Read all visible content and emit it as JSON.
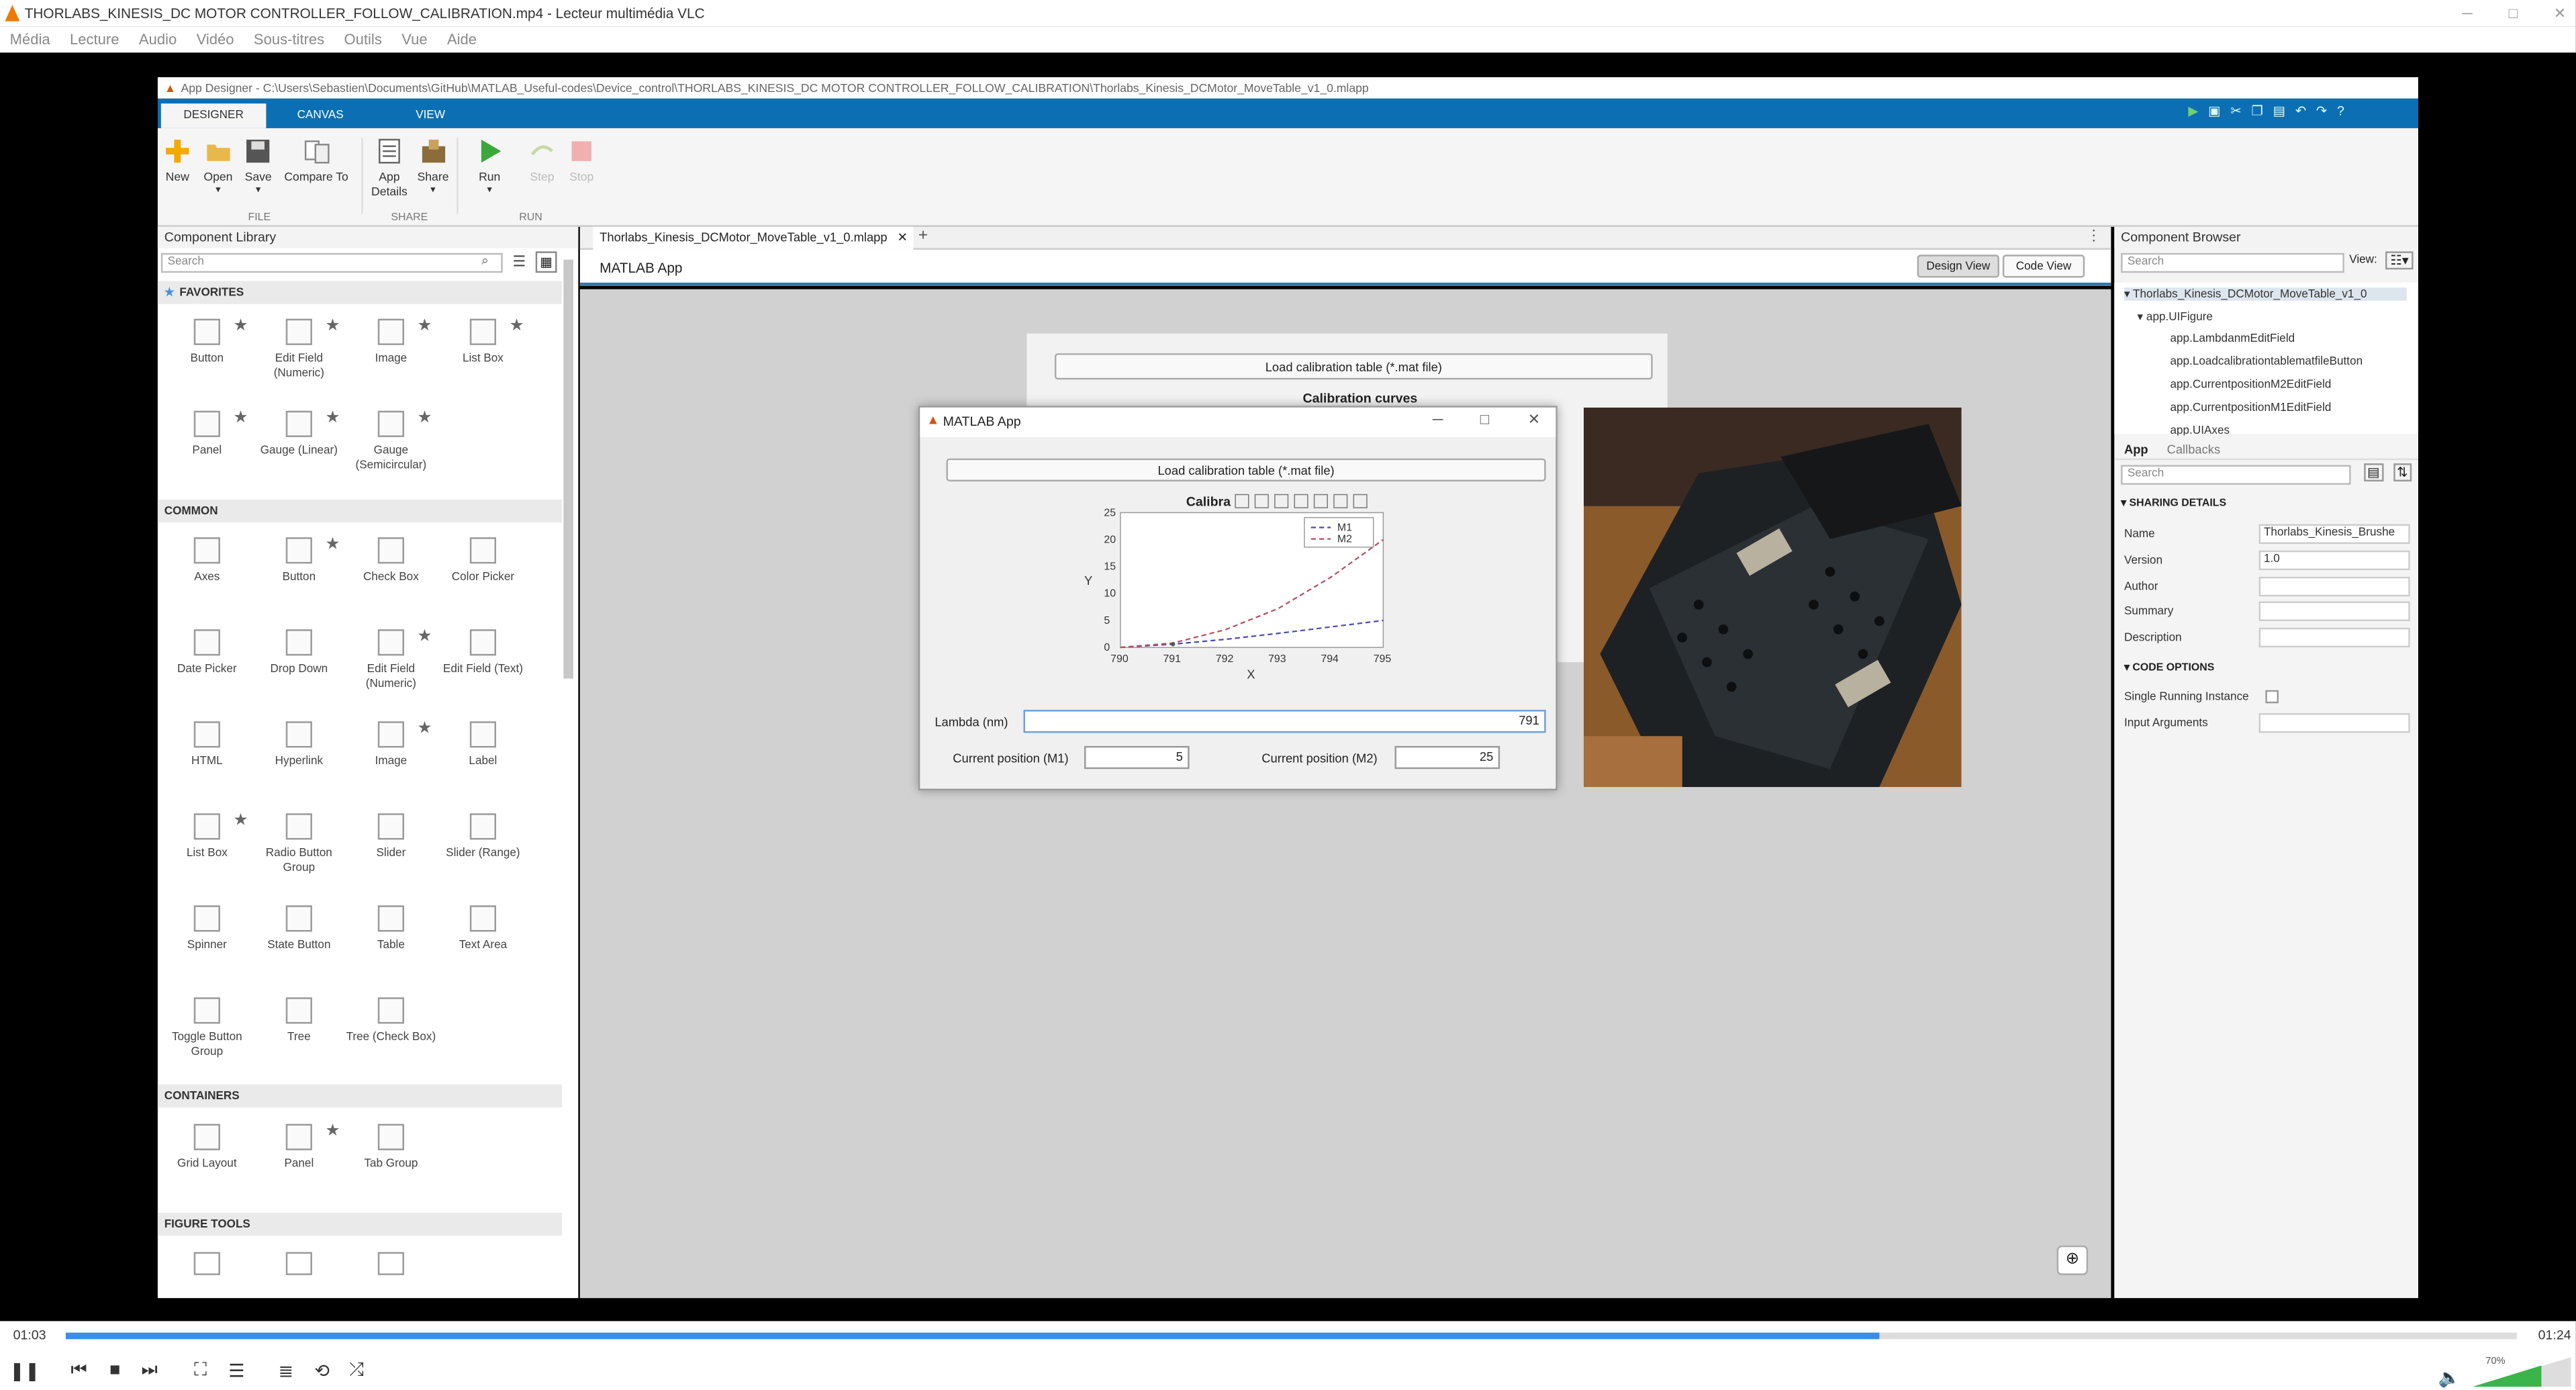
{
  "vlc": {
    "title": "THORLABS_KINESIS_DC MOTOR CONTROLLER_FOLLOW_CALIBRATION.mp4 - Lecteur multimédia VLC",
    "menu": [
      "Média",
      "Lecture",
      "Audio",
      "Vidéo",
      "Sous-titres",
      "Outils",
      "Vue",
      "Aide"
    ],
    "time_elapsed": "01:03",
    "time_total": "01:24",
    "progress": 0.74,
    "volume": "70%"
  },
  "appdesigner": {
    "title": "App Designer - C:\\Users\\Sebastien\\Documents\\GitHub\\MATLAB_Useful-codes\\Device_control\\THORLABS_KINESIS_DC MOTOR CONTROLLER_FOLLOW_CALIBRATION\\Thorlabs_Kinesis_DCMotor_MoveTable_v1_0.mlapp",
    "tabs": [
      "DESIGNER",
      "CANVAS",
      "VIEW"
    ],
    "ribbon": {
      "new": "New",
      "open": "Open",
      "save": "Save",
      "compare": "Compare To",
      "app_details": "App Details",
      "share": "Share",
      "run": "Run",
      "step": "Step",
      "stop": "Stop",
      "group_file": "FILE",
      "group_share": "SHARE",
      "group_run": "RUN"
    },
    "component_library": {
      "header": "Component Library",
      "search_placeholder": "Search",
      "favorites": {
        "label": "FAVORITES",
        "items": [
          "Button",
          "Edit Field (Numeric)",
          "Image",
          "List Box",
          "Panel",
          "Gauge (Linear)",
          "Gauge (Semicircular)"
        ]
      },
      "common": {
        "label": "COMMON",
        "items": [
          "Axes",
          "Button",
          "Check Box",
          "Color Picker",
          "Date Picker",
          "Drop Down",
          "Edit Field (Numeric)",
          "Edit Field (Text)",
          "HTML",
          "Hyperlink",
          "Image",
          "Label",
          "List Box",
          "Radio Button Group",
          "Slider",
          "Slider (Range)",
          "Spinner",
          "State Button",
          "Table",
          "Text Area",
          "Toggle Button Group",
          "Tree",
          "Tree (Check Box)"
        ]
      },
      "containers": {
        "label": "CONTAINERS",
        "items": [
          "Grid Layout",
          "Panel",
          "Tab Group"
        ]
      },
      "figure_tools": {
        "label": "FIGURE TOOLS"
      }
    },
    "doc_tab": "Thorlabs_Kinesis_DCMotor_MoveTable_v1_0.mlapp",
    "canvas_title": "MATLAB App",
    "design_view": "Design View",
    "code_view": "Code View",
    "bg_button": "Load calibration table (*.mat file)",
    "bg_title": "Calibration curves",
    "component_browser": {
      "header": "Component Browser",
      "search_placeholder": "Search",
      "view_label": "View:",
      "tree": [
        "Thorlabs_Kinesis_DCMotor_MoveTable_v1_0",
        "app.UIFigure",
        "app.LambdanmEditField",
        "app.LoadcalibrationtablematfileButton",
        "app.CurrentpositionM2EditField",
        "app.CurrentpositionM1EditField",
        "app.UIAxes"
      ]
    },
    "inspector": {
      "tab_app": "App",
      "tab_callbacks": "Callbacks",
      "search_placeholder": "Search",
      "sharing": "SHARING DETAILS",
      "name_label": "Name",
      "name_value": "Thorlabs_Kinesis_Brushe",
      "version_label": "Version",
      "version_value": "1.0",
      "author_label": "Author",
      "summary_label": "Summary",
      "description_label": "Description",
      "code_options": "CODE OPTIONS",
      "single_running": "Single Running Instance",
      "input_args": "Input Arguments"
    }
  },
  "app": {
    "title": "MATLAB App",
    "load_button": "Load calibration table (*.mat file)",
    "lambda_label": "Lambda (nm)",
    "lambda_value": "791",
    "m1_label": "Current position (M1)",
    "m1_value": "5",
    "m2_label": "Current position (M2)",
    "m2_value": "25"
  },
  "chart_data": {
    "type": "line",
    "title": "Calibra",
    "xlabel": "X",
    "ylabel": "Y",
    "xlim": [
      790,
      795
    ],
    "ylim": [
      0,
      25
    ],
    "x_ticks": [
      "790",
      "791",
      "792",
      "793",
      "794",
      "795"
    ],
    "y_ticks": [
      "0",
      "5",
      "10",
      "15",
      "20",
      "25"
    ],
    "legend_position": "top-right",
    "series": [
      {
        "name": "M1",
        "color": "#4a4ab0",
        "x": [
          790,
          791,
          792,
          793,
          794,
          795
        ],
        "y": [
          0,
          0.6,
          1.5,
          2.6,
          3.8,
          5
        ]
      },
      {
        "name": "M2",
        "color": "#b05060",
        "x": [
          790,
          791,
          792,
          793,
          794,
          795
        ],
        "y": [
          0,
          0.8,
          3.3,
          7.2,
          13,
          20
        ]
      }
    ],
    "marker_point": {
      "x": 791,
      "y": 0.6
    }
  }
}
